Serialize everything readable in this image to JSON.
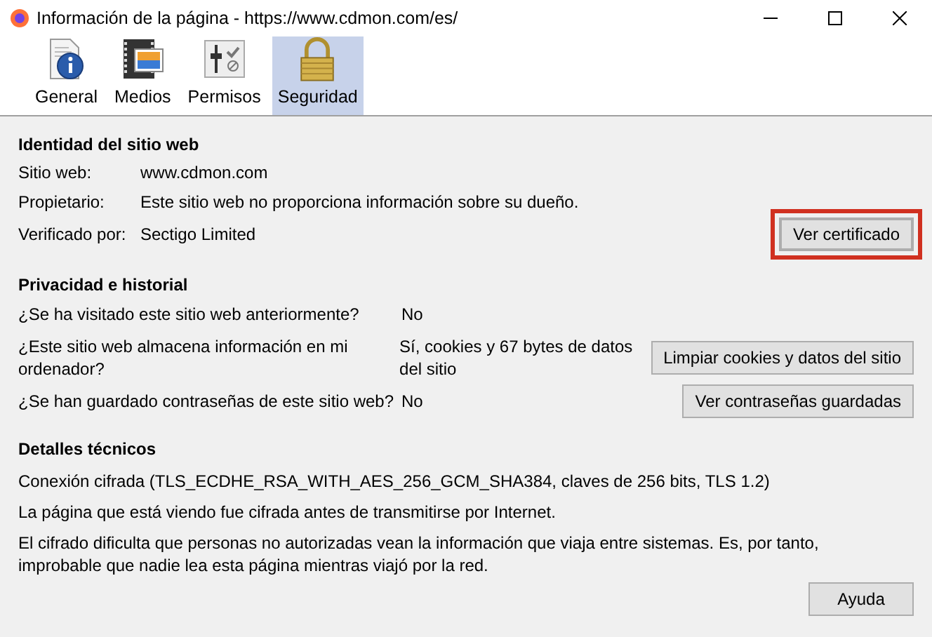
{
  "window": {
    "title": "Información de la página - https://www.cdmon.com/es/"
  },
  "tabs": [
    {
      "label": "General",
      "kind": "info",
      "selected": false
    },
    {
      "label": "Medios",
      "kind": "media",
      "selected": false
    },
    {
      "label": "Permisos",
      "kind": "perms",
      "selected": false
    },
    {
      "label": "Seguridad",
      "kind": "lock",
      "selected": true
    }
  ],
  "identity": {
    "title": "Identidad del sitio web",
    "rows": [
      {
        "label": "Sitio web:",
        "value": "www.cdmon.com"
      },
      {
        "label": "Propietario:",
        "value": "Este sitio web no proporciona información sobre su dueño."
      },
      {
        "label": "Verificado por:",
        "value": "Sectigo Limited"
      }
    ],
    "button": {
      "label": "Ver certificado",
      "highlighted": true
    }
  },
  "privacy": {
    "title": "Privacidad e historial",
    "rows": [
      {
        "question": "¿Se ha visitado este sitio web anteriormente?",
        "answer": "No"
      },
      {
        "question": "¿Este sitio web almacena información en mi ordenador?",
        "answer": "Sí, cookies y 67 bytes de datos del sitio",
        "button": "Limpiar cookies y datos del sitio"
      },
      {
        "question": "¿Se han guardado contraseñas de este sitio web?",
        "answer": "No",
        "button": "Ver contraseñas guardadas"
      }
    ]
  },
  "technical": {
    "title": "Detalles técnicos",
    "lines": [
      "Conexión cifrada (TLS_ECDHE_RSA_WITH_AES_256_GCM_SHA384, claves de 256 bits, TLS 1.2)",
      "La página que está viendo fue cifrada antes de transmitirse por Internet.",
      "El cifrado dificulta que personas no autorizadas vean la información que viaja entre sistemas. Es, por tanto, improbable que nadie lea esta página mientras viajó por la red."
    ]
  },
  "help_button": "Ayuda"
}
